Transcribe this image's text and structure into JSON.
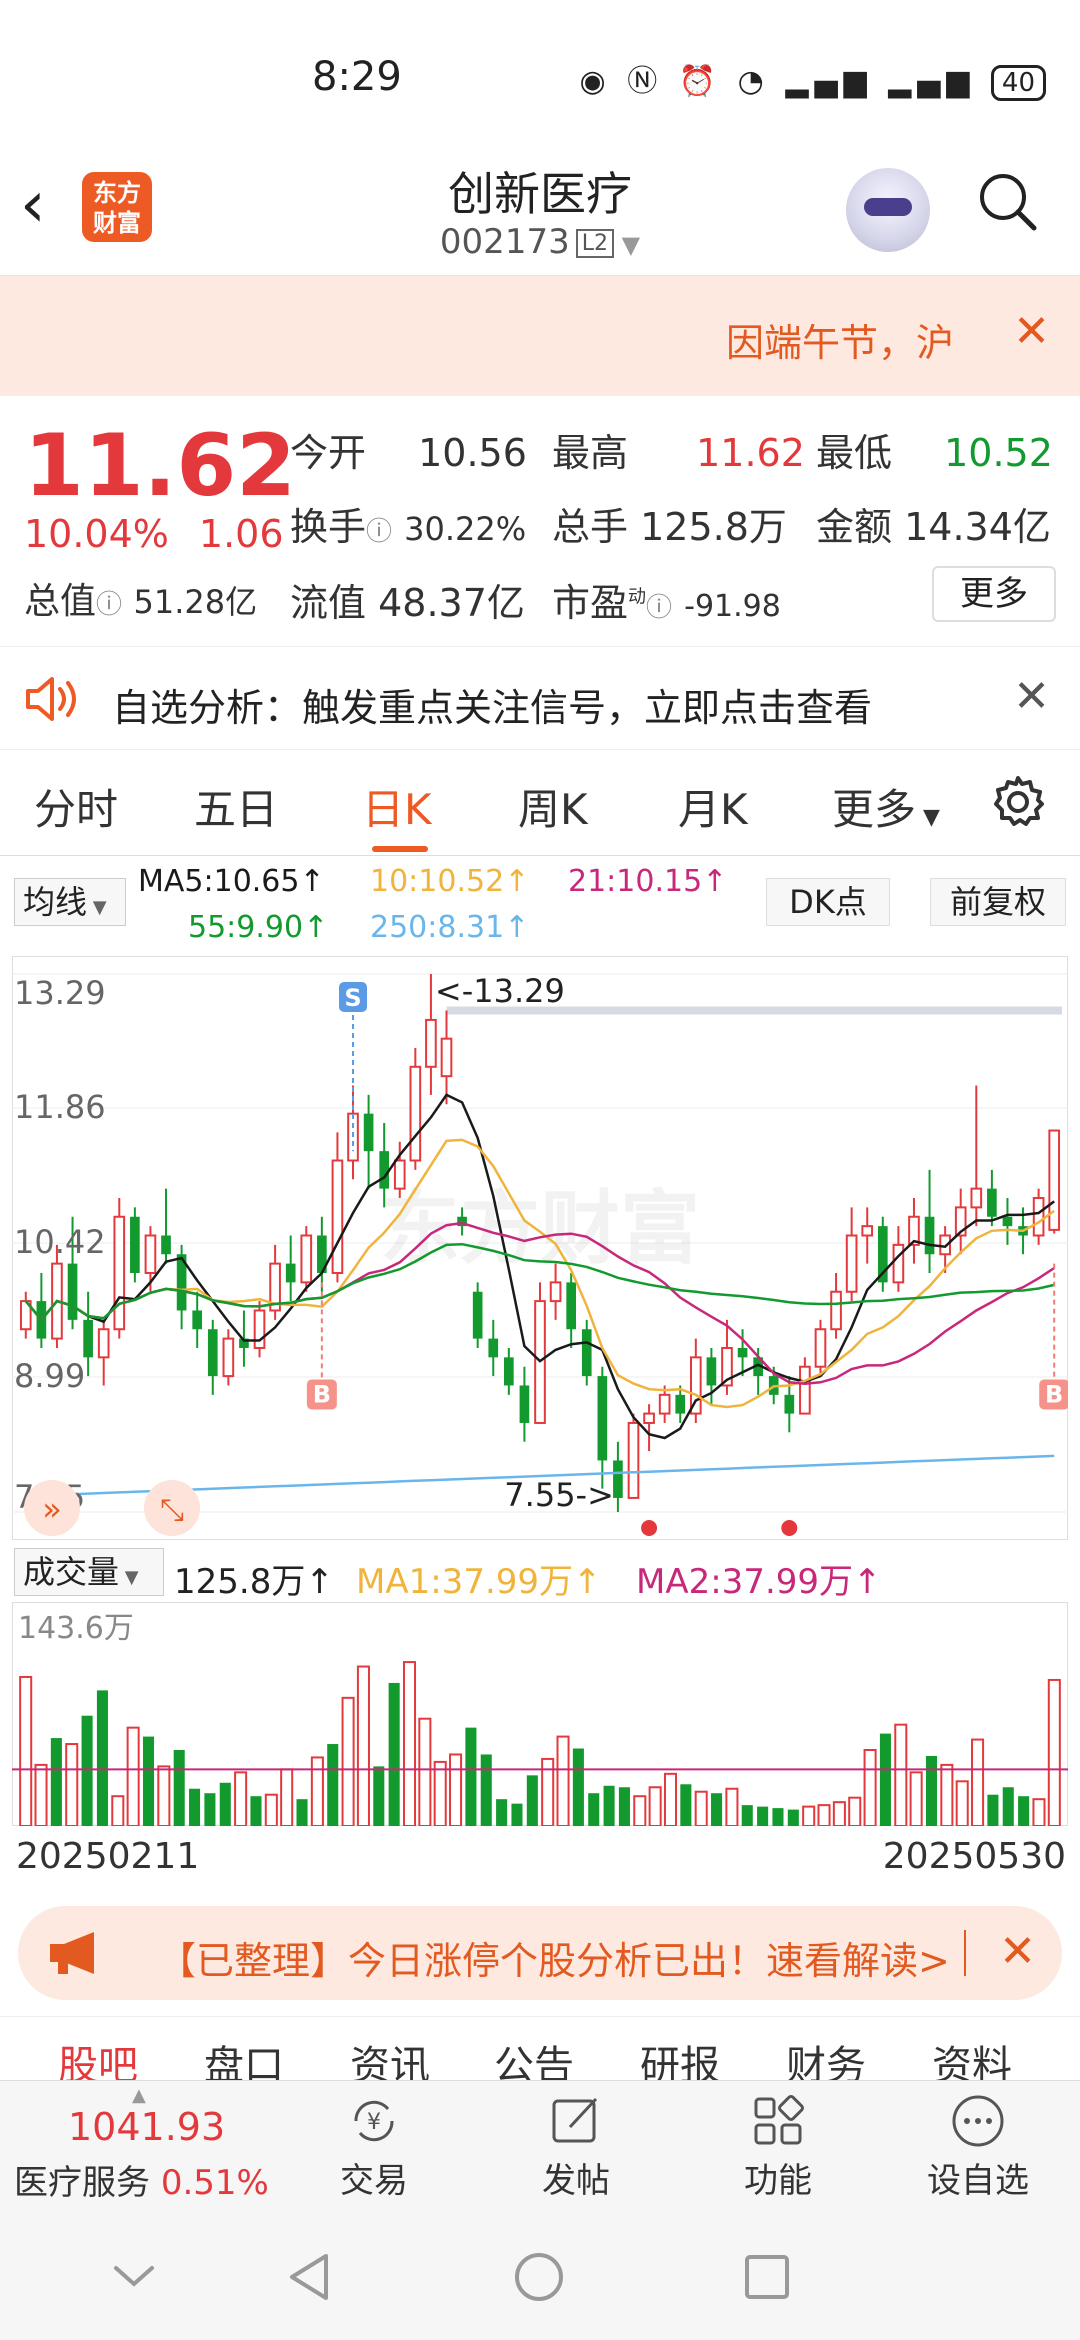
{
  "status_bar": {
    "time": "8:29",
    "icons": [
      "eye-icon",
      "nfc-icon",
      "alarm-icon",
      "wifi-icon",
      "5g-signal-icon",
      "4g-signal-icon"
    ],
    "battery": "40"
  },
  "header": {
    "name": "创新医疗",
    "code": "002173",
    "level": "L2",
    "logo_text": "东方财富"
  },
  "notice": {
    "text": "因端午节，沪"
  },
  "quote": {
    "price": "11.62",
    "change_pct": "10.04%",
    "change": "1.06",
    "items": [
      {
        "label": "今开",
        "value": "10.56",
        "color": "#333333"
      },
      {
        "label": "最高",
        "value": "11.62",
        "color": "#e4393c"
      },
      {
        "label": "最低",
        "value": "10.52",
        "color": "#129a2e"
      },
      {
        "label": "换手",
        "value": "30.22%",
        "color": "#333333"
      },
      {
        "label": "总手",
        "value": "125.8万",
        "color": "#333333"
      },
      {
        "label": "金额",
        "value": "14.34亿",
        "color": "#333333"
      },
      {
        "label": "流值",
        "value": "48.37亿",
        "color": "#333333"
      },
      {
        "label": "市盈",
        "value": "-91.98",
        "color": "#333333"
      }
    ],
    "total_value_label": "总值",
    "total_value": "51.28亿",
    "pe_sup": "动",
    "more": "更多"
  },
  "analysis": {
    "text": "自选分析：触发重点关注信号，立即点击查看"
  },
  "tabs": [
    "分时",
    "五日",
    "日K",
    "周K",
    "月K",
    "更多"
  ],
  "active_tab": "日K",
  "ma_legend": {
    "button": "均线",
    "ma5": "MA5:10.65↑",
    "ma10": "10:10.52↑",
    "ma21": "21:10.15↑",
    "ma55": "55:9.90↑",
    "ma250": "250:8.31↑",
    "dk": "DK点",
    "fq": "前复权"
  },
  "chart_data": {
    "type": "candlestick",
    "y_ticks": [
      "13.29",
      "11.86",
      "10.42",
      "8.99",
      "7.55"
    ],
    "ylim": [
      7.55,
      13.29
    ],
    "max_label": "<-13.29",
    "min_label": "7.55->",
    "signals": {
      "sell": "S",
      "buy": "B"
    },
    "start_date": "20250211",
    "end_date": "20250530",
    "candles": [
      [
        9.5,
        9.9,
        9.4,
        9.8
      ],
      [
        9.8,
        10.1,
        9.3,
        9.4
      ],
      [
        9.4,
        10.4,
        9.3,
        10.2
      ],
      [
        10.2,
        10.7,
        9.5,
        9.6
      ],
      [
        9.6,
        9.9,
        9.0,
        9.2
      ],
      [
        9.2,
        9.6,
        8.9,
        9.5
      ],
      [
        9.5,
        10.9,
        9.4,
        10.7
      ],
      [
        10.7,
        10.8,
        10.0,
        10.1
      ],
      [
        10.1,
        10.6,
        9.9,
        10.5
      ],
      [
        10.5,
        11.0,
        10.2,
        10.3
      ],
      [
        10.3,
        10.4,
        9.5,
        9.7
      ],
      [
        9.7,
        9.9,
        9.3,
        9.5
      ],
      [
        9.5,
        9.6,
        8.8,
        9.0
      ],
      [
        9.0,
        9.5,
        8.9,
        9.4
      ],
      [
        9.4,
        9.7,
        9.1,
        9.3
      ],
      [
        9.3,
        9.8,
        9.2,
        9.7
      ],
      [
        9.7,
        10.4,
        9.6,
        10.2
      ],
      [
        10.2,
        10.5,
        9.8,
        10.0
      ],
      [
        10.0,
        10.6,
        9.9,
        10.5
      ],
      [
        10.5,
        10.7,
        9.9,
        10.1
      ],
      [
        10.1,
        11.6,
        10.0,
        11.3
      ],
      [
        11.3,
        12.1,
        11.1,
        11.8
      ],
      [
        11.8,
        12.0,
        11.0,
        11.4
      ],
      [
        11.4,
        11.7,
        10.8,
        11.0
      ],
      [
        11.0,
        11.5,
        10.9,
        11.3
      ],
      [
        11.3,
        12.5,
        11.2,
        12.3
      ],
      [
        12.3,
        13.29,
        12.0,
        12.8
      ],
      [
        12.2,
        12.9,
        11.9,
        12.6
      ],
      [
        10.7,
        10.8,
        10.5,
        10.6
      ],
      [
        9.9,
        10.0,
        9.3,
        9.4
      ],
      [
        9.4,
        9.6,
        9.0,
        9.2
      ],
      [
        9.2,
        9.3,
        8.8,
        8.9
      ],
      [
        8.9,
        9.1,
        8.3,
        8.5
      ],
      [
        8.5,
        10.0,
        8.5,
        9.8
      ],
      [
        9.8,
        10.2,
        9.6,
        10.0
      ],
      [
        10.0,
        10.1,
        9.3,
        9.5
      ],
      [
        9.5,
        9.6,
        8.9,
        9.0
      ],
      [
        9.0,
        9.1,
        7.8,
        8.1
      ],
      [
        8.1,
        8.3,
        7.55,
        7.7
      ],
      [
        7.7,
        8.6,
        7.7,
        8.5
      ],
      [
        8.5,
        8.7,
        8.2,
        8.6
      ],
      [
        8.6,
        8.9,
        8.5,
        8.8
      ],
      [
        8.8,
        8.9,
        8.5,
        8.6
      ],
      [
        8.6,
        9.4,
        8.5,
        9.2
      ],
      [
        9.2,
        9.3,
        8.7,
        8.9
      ],
      [
        8.9,
        9.6,
        8.8,
        9.3
      ],
      [
        9.3,
        9.5,
        9.0,
        9.2
      ],
      [
        9.2,
        9.3,
        8.8,
        9.0
      ],
      [
        9.0,
        9.1,
        8.7,
        8.8
      ],
      [
        8.8,
        9.0,
        8.4,
        8.6
      ],
      [
        8.6,
        9.2,
        8.6,
        9.1
      ],
      [
        9.1,
        9.6,
        9.0,
        9.5
      ],
      [
        9.5,
        10.1,
        9.4,
        9.9
      ],
      [
        9.9,
        10.8,
        9.8,
        10.5
      ],
      [
        10.5,
        10.8,
        10.2,
        10.6
      ],
      [
        10.6,
        10.7,
        9.9,
        10.0
      ],
      [
        10.0,
        10.6,
        9.9,
        10.4
      ],
      [
        10.4,
        10.9,
        10.2,
        10.7
      ],
      [
        10.7,
        11.2,
        10.1,
        10.3
      ],
      [
        10.3,
        10.6,
        10.1,
        10.5
      ],
      [
        10.5,
        11.0,
        10.3,
        10.8
      ],
      [
        10.8,
        12.1,
        10.6,
        11.0
      ],
      [
        11.0,
        11.2,
        10.6,
        10.7
      ],
      [
        10.7,
        10.9,
        10.4,
        10.6
      ],
      [
        10.6,
        10.8,
        10.3,
        10.5
      ],
      [
        10.5,
        11.0,
        10.4,
        10.9
      ],
      [
        10.56,
        11.62,
        10.52,
        11.62
      ]
    ],
    "volumes": [
      100,
      41,
      59,
      55,
      74,
      91,
      20,
      66,
      60,
      40,
      51,
      25,
      22,
      29,
      36,
      20,
      21,
      38,
      18,
      46,
      55,
      86,
      107,
      40,
      96,
      110,
      72,
      43,
      48,
      66,
      48,
      18,
      15,
      34,
      45,
      60,
      52,
      22,
      27,
      26,
      20,
      26,
      35,
      28,
      23,
      22,
      25,
      14,
      13,
      12,
      11,
      13,
      14,
      16,
      19,
      51,
      62,
      68,
      36,
      47,
      41,
      30,
      58,
      21,
      26,
      20,
      18,
      98
    ],
    "ma_lines": [
      {
        "name": "MA5",
        "color": "#1a1a1a"
      },
      {
        "name": "MA10",
        "color": "#f0b43c"
      },
      {
        "name": "MA21",
        "color": "#c8287a"
      },
      {
        "name": "MA55",
        "color": "#129a2e"
      },
      {
        "name": "MA250",
        "color": "#6ab6ea"
      }
    ],
    "volume_max_label": "143.6万"
  },
  "volume_legend": {
    "button": "成交量",
    "value": "125.8万↑",
    "ma1": "MA1:37.99万↑",
    "ma2": "MA2:37.99万↑"
  },
  "promo": {
    "text": "【已整理】今日涨停个股分析已出！速看解读>"
  },
  "sub_tabs": [
    "股吧",
    "盘口",
    "资讯",
    "公告",
    "研报",
    "财务",
    "资料"
  ],
  "bottom_bar": {
    "index_value": "1041.93",
    "index_name": "医疗服务",
    "index_pct": "0.51%",
    "items": [
      "交易",
      "发帖",
      "功能",
      "设自选"
    ]
  },
  "colors": {
    "up": "#e4393c",
    "down": "#129a2e",
    "accent": "#ee5a24"
  }
}
